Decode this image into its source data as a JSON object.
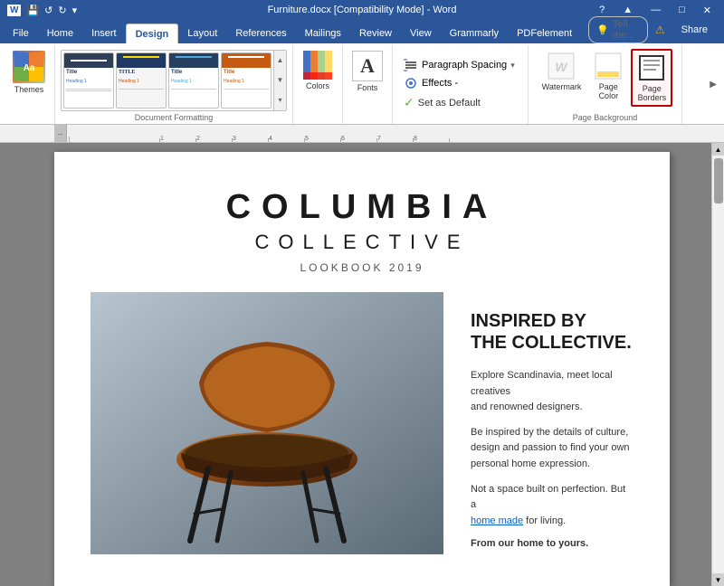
{
  "titleBar": {
    "appName": "Furniture.docx [Compatibility Mode] - Word",
    "buttons": [
      "—",
      "□",
      "✕"
    ]
  },
  "quickAccess": {
    "saveIcon": "💾",
    "undoIcon": "↺",
    "redoIcon": "↻"
  },
  "ribbonTabs": {
    "tabs": [
      "File",
      "Home",
      "Insert",
      "Design",
      "Layout",
      "References",
      "Mailings",
      "Review",
      "View",
      "Grammarly",
      "PDFelement"
    ],
    "activeTab": "Design"
  },
  "groups": {
    "themes": {
      "label": "Themes"
    },
    "documentFormatting": {
      "label": "Document Formatting"
    },
    "colors": {
      "label": "Colors"
    },
    "fonts": {
      "label": "Fonts"
    },
    "paragraphSpacing": {
      "label": "Paragraph Spacing"
    },
    "effects": {
      "label": "Effects"
    },
    "setAsDefault": {
      "label": "Set as Default"
    },
    "pageBackground": {
      "label": "Page Background"
    }
  },
  "buttons": {
    "paragraphSpacing": "Paragraph Spacing",
    "paragraphSpacingArrow": "▾",
    "effects": "Effects -",
    "setAsDefault": "Set as Default",
    "watermark": "Watermark",
    "pageColor": "Page\nColor",
    "pageBorders": "Page\nBorders"
  },
  "tellMe": {
    "placeholder": "Tell me..."
  },
  "shareBtn": {
    "label": "Share"
  },
  "document": {
    "title1": "COLUMBIA",
    "title2": "COLLECTIVE",
    "subtitle": "LOOKBOOK 2019",
    "inspiredTitle": "INSPIRED BY\nTHE COLLECTIVE.",
    "inspiredLine1": "Explore Scandinavia, meet local creatives",
    "inspiredLine2": "and renowned designers.",
    "inspiredLine3": "Be inspired by the details of culture,",
    "inspiredLine4": "design and passion to find your own",
    "inspiredLine5": "personal home expression.",
    "inspiredLine6": "Not a space built on perfection. But a",
    "homeMade": "home made",
    "forLiving": " for living.",
    "fromHome": "From our home to yours."
  }
}
